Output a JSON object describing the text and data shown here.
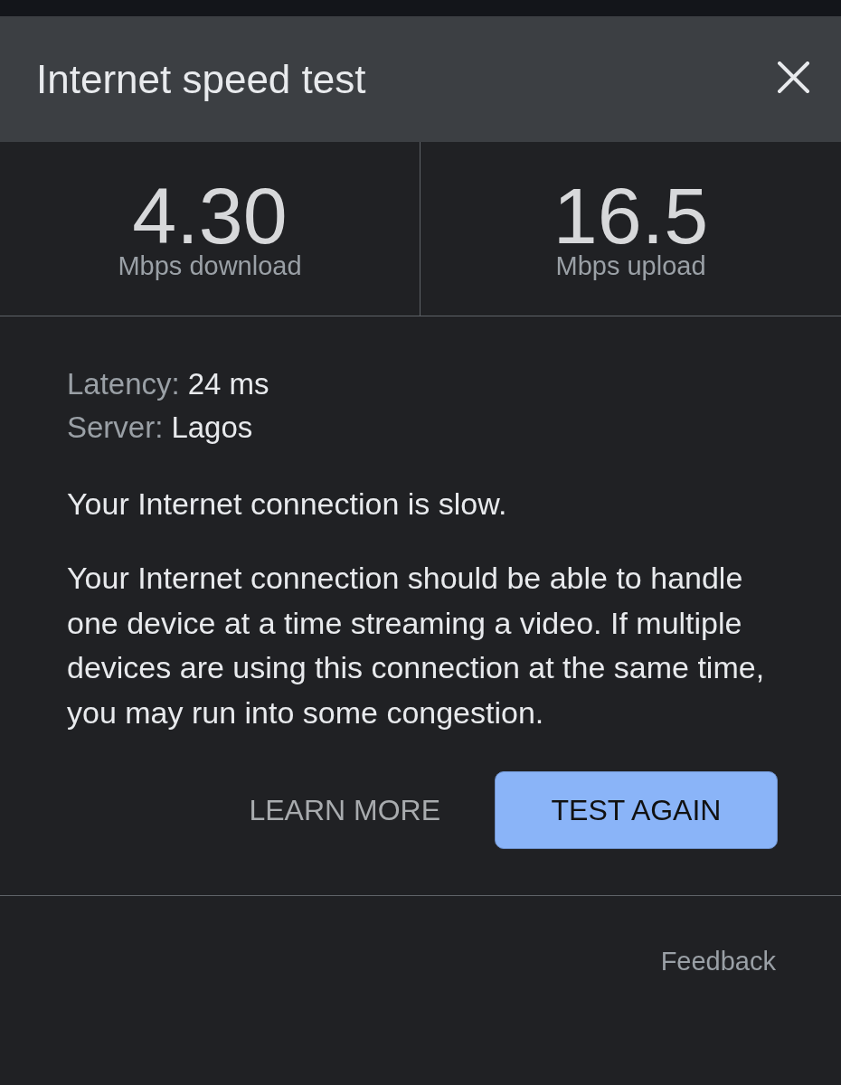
{
  "dialog": {
    "title": "Internet speed test"
  },
  "results": [
    {
      "value": "4.30",
      "label": "Mbps download"
    },
    {
      "value": "16.5",
      "label": "Mbps upload"
    }
  ],
  "details": [
    {
      "label": "Latency:",
      "value": "24 ms"
    },
    {
      "label": "Server:",
      "value": "Lagos"
    }
  ],
  "summary": "Your Internet connection is slow.",
  "description": "Your Internet connection should be able to handle one device at a time streaming a video. If multiple devices are using this connection at the same time, you may run into some congestion.",
  "buttons": [
    {
      "label": "LEARN MORE",
      "kind": "text"
    },
    {
      "label": "TEST AGAIN",
      "kind": "filled"
    }
  ],
  "footer": {
    "link": "Feedback"
  }
}
